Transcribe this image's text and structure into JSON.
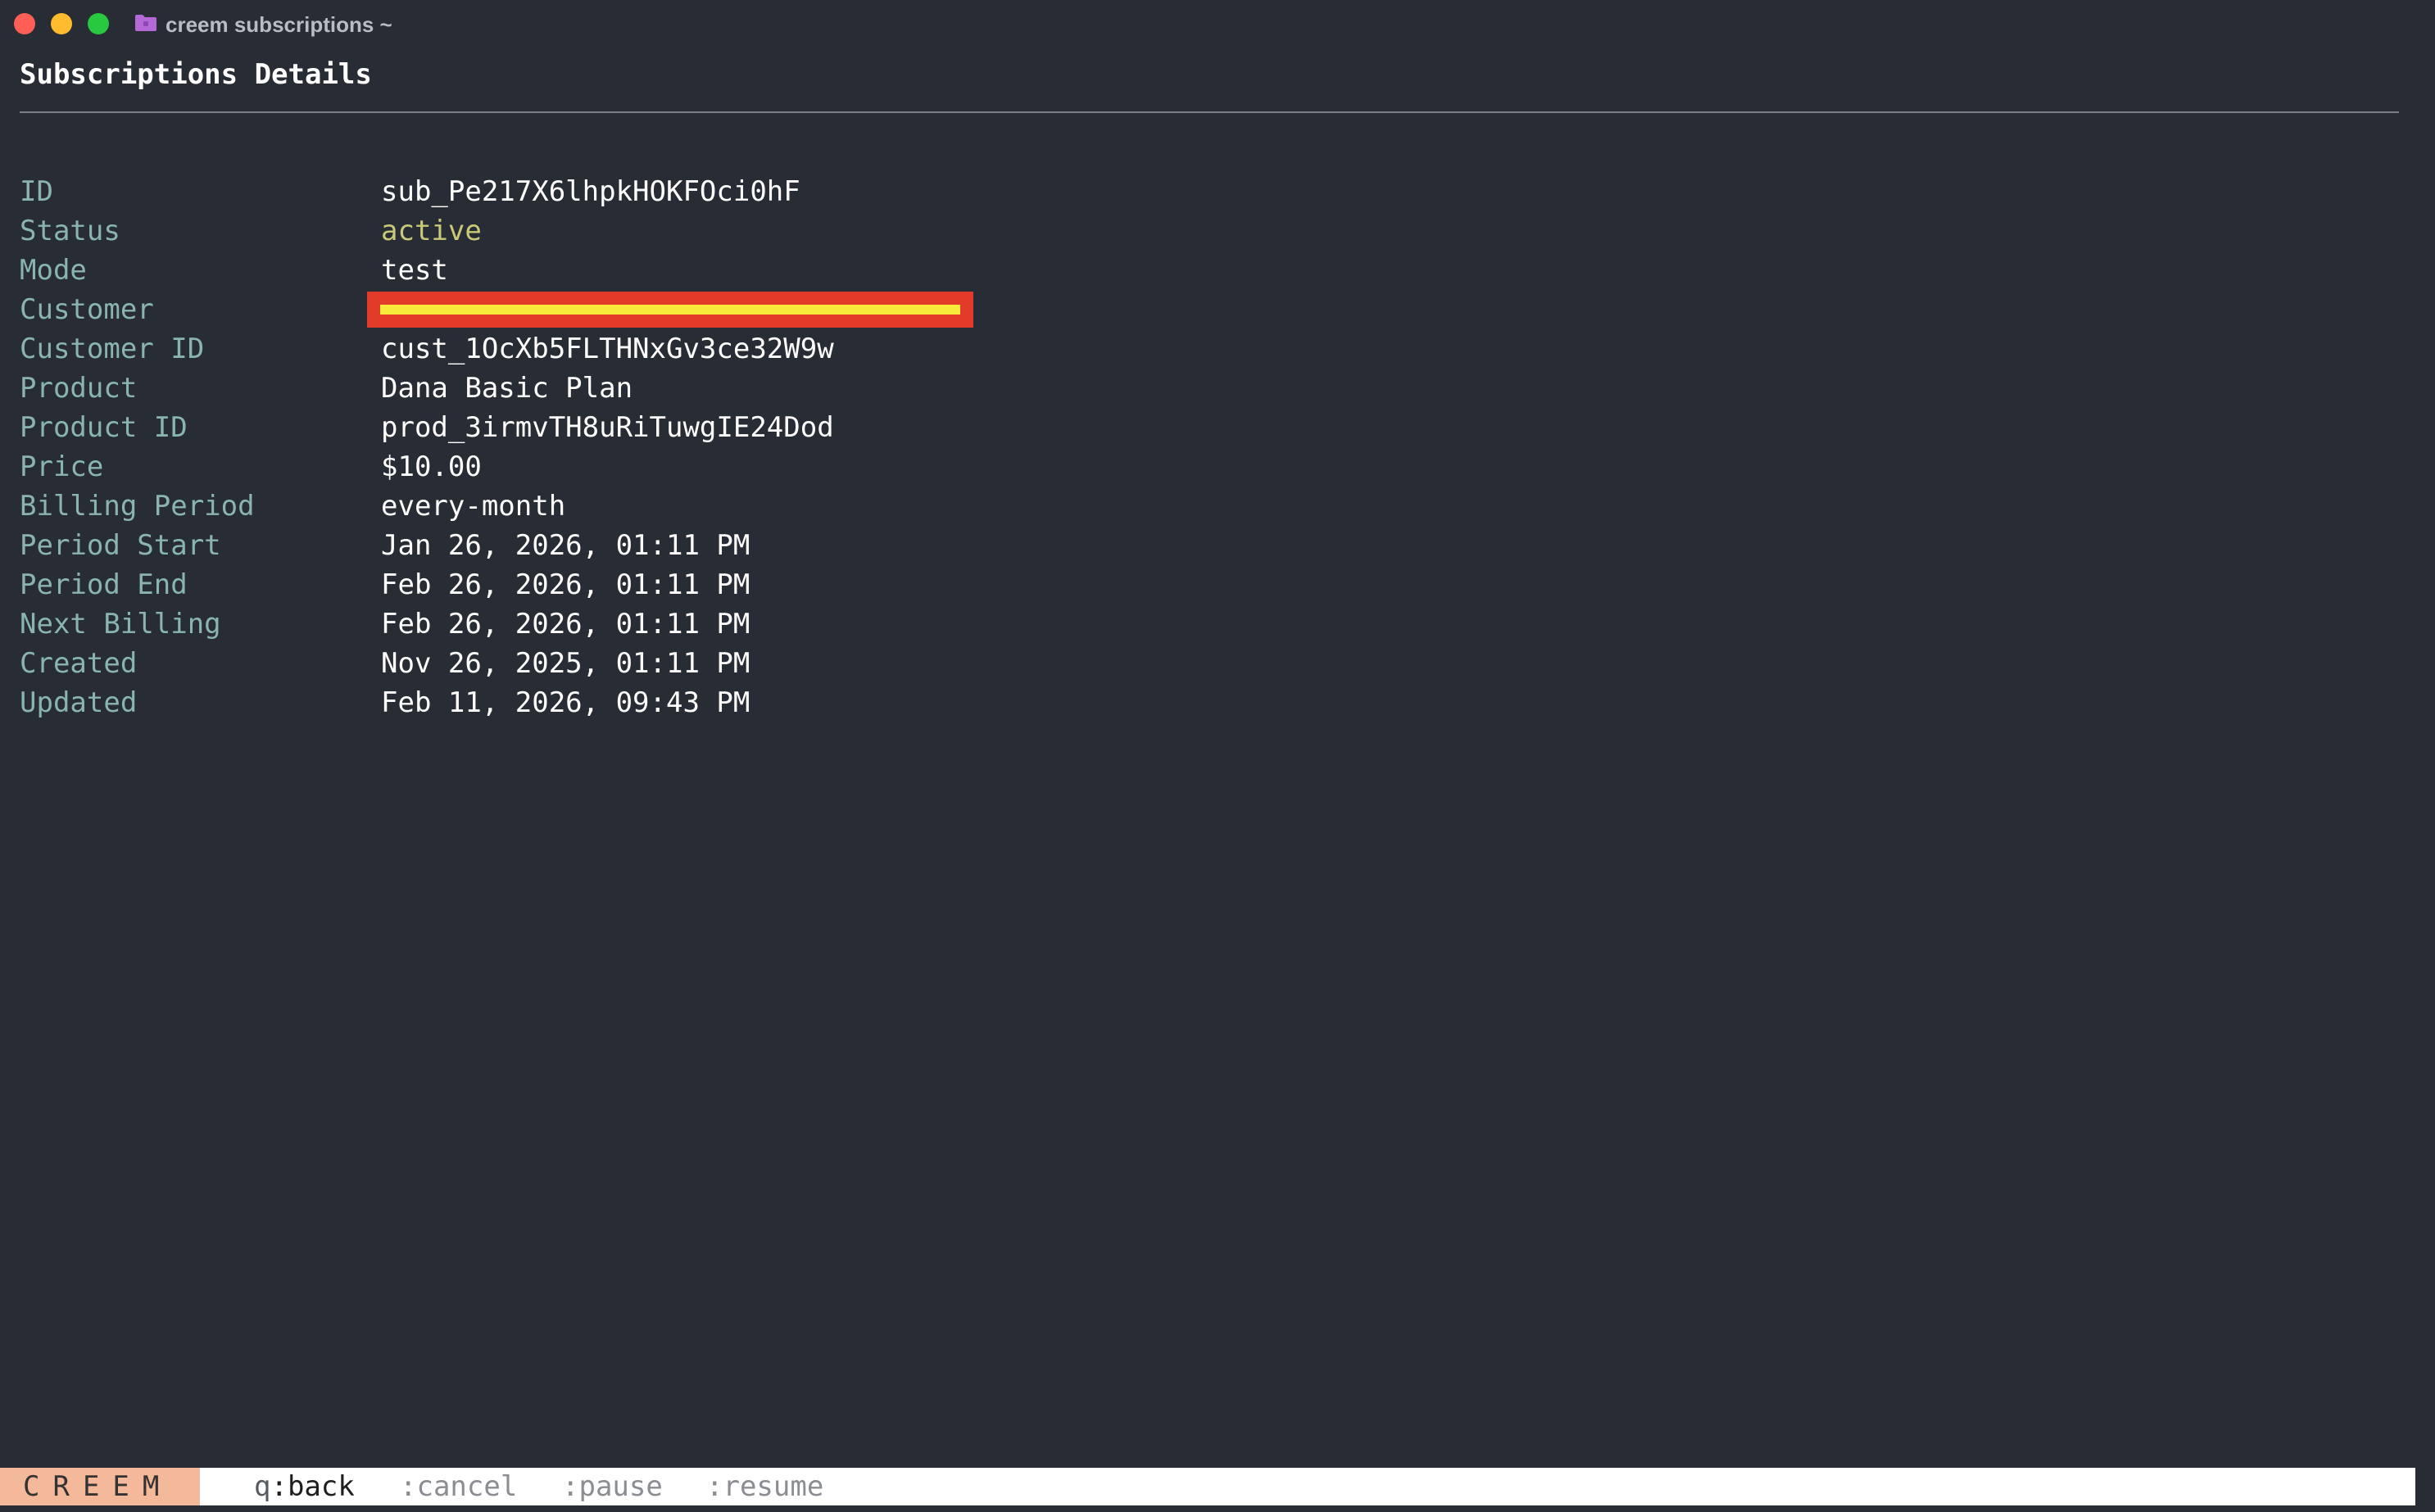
{
  "window": {
    "title": "creem subscriptions ~",
    "icon": "folder-icon",
    "folder_color": "#b569d6"
  },
  "page": {
    "title": "Subscriptions Details"
  },
  "details": {
    "rows": [
      {
        "label": "ID",
        "value": "sub_Pe217X6lhpkHOKFOci0hF"
      },
      {
        "label": "Status",
        "value": "active"
      },
      {
        "label": "Mode",
        "value": "test"
      },
      {
        "label": "Customer",
        "value": ""
      },
      {
        "label": "Customer ID",
        "value": "cust_1OcXb5FLTHNxGv3ce32W9w"
      },
      {
        "label": "Product",
        "value": "Dana Basic Plan"
      },
      {
        "label": "Product ID",
        "value": "prod_3irmvTH8uRiTuwgIE24Dod"
      },
      {
        "label": "Price",
        "value": "$10.00"
      },
      {
        "label": "Billing Period",
        "value": "every-month"
      },
      {
        "label": "Period Start",
        "value": "Jan 26, 2026, 01:11 PM"
      },
      {
        "label": "Period End",
        "value": "Feb 26, 2026, 01:11 PM"
      },
      {
        "label": "Next Billing",
        "value": "Feb 26, 2026, 01:11 PM"
      },
      {
        "label": "Created",
        "value": "Nov 26, 2025, 01:11 PM"
      },
      {
        "label": "Updated",
        "value": "Feb 11, 2026, 09:43 PM"
      }
    ]
  },
  "statusbar": {
    "brand": "CREEM",
    "hints": [
      {
        "key": "q",
        "action": ":back"
      },
      {
        "key": "",
        "action": ":cancel"
      },
      {
        "key": "",
        "action": ":pause"
      },
      {
        "key": "",
        "action": ":resume"
      }
    ]
  },
  "colors": {
    "background": "#282c34",
    "label": "#8ab4b0",
    "value": "#ffffff",
    "status_active": "#c9c978",
    "redaction_outer": "#e33b2a",
    "redaction_inner": "#f7ea3a",
    "brand_bg": "#f4b89a"
  }
}
